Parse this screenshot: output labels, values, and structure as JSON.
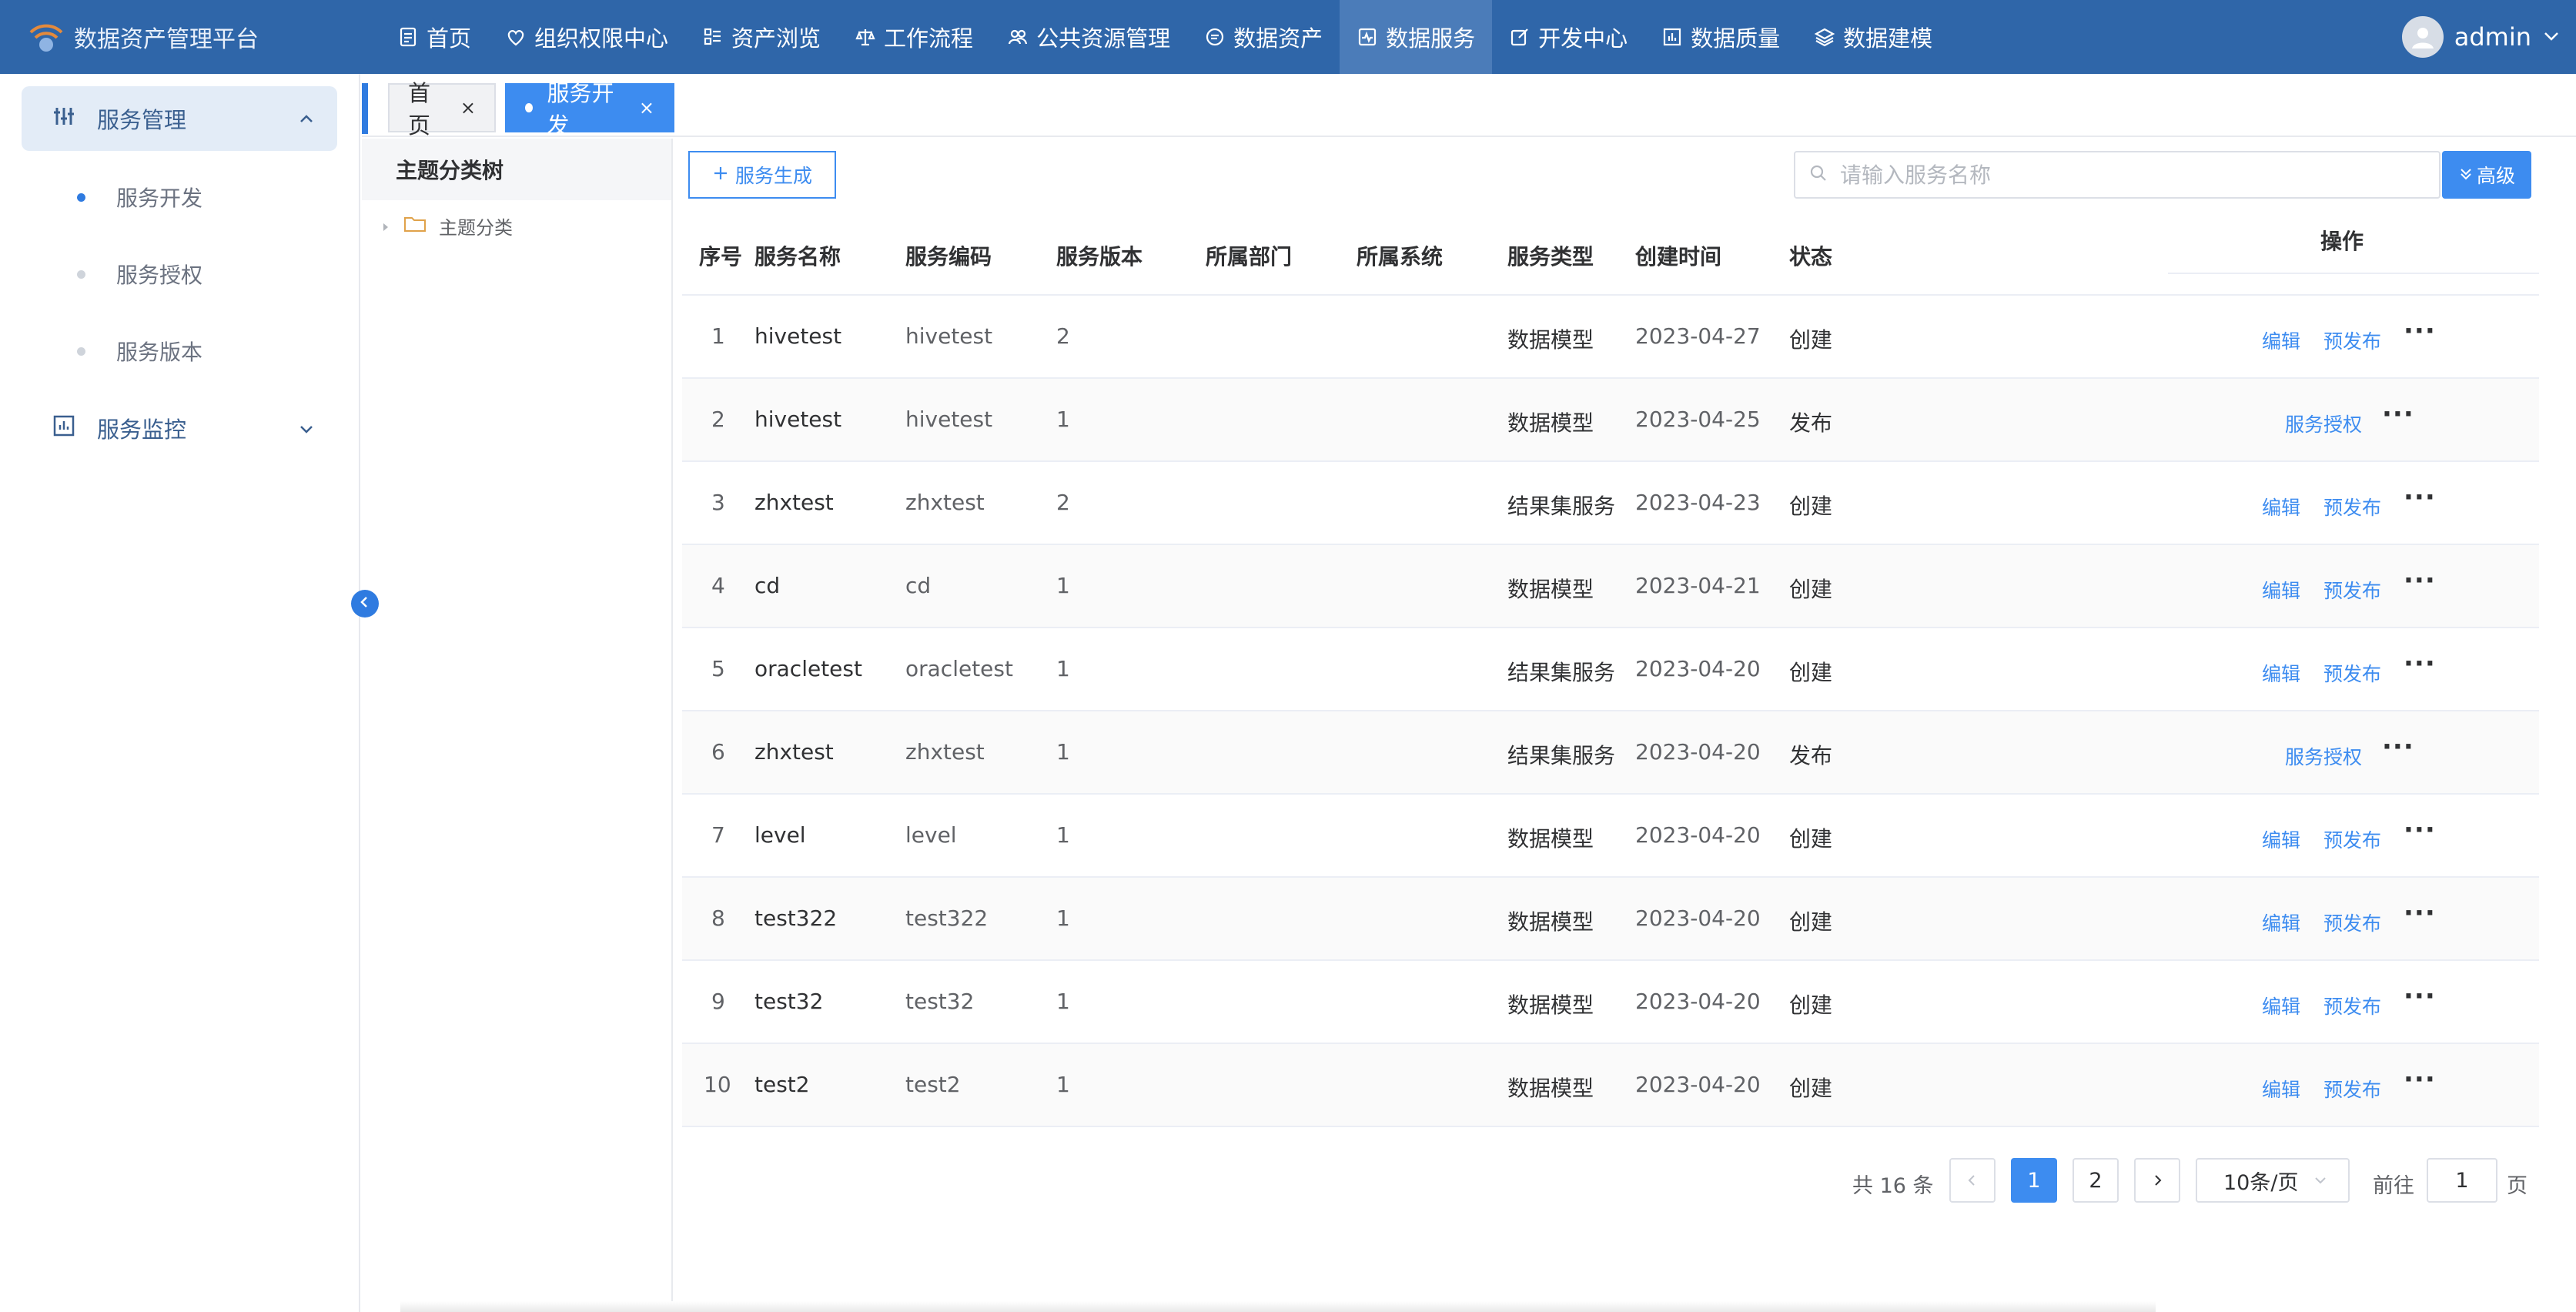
{
  "app": {
    "title": "数据资产管理平台"
  },
  "colors": {
    "header": "#2f66a9",
    "accent": "#3d8cf0",
    "header_active": "#4b7cb9"
  },
  "nav": {
    "items": [
      {
        "label": "首页",
        "icon": "document-icon"
      },
      {
        "label": "组织权限中心",
        "icon": "heart-icon"
      },
      {
        "label": "资产浏览",
        "icon": "list-icon"
      },
      {
        "label": "工作流程",
        "icon": "scale-icon"
      },
      {
        "label": "公共资源管理",
        "icon": "people-icon"
      },
      {
        "label": "数据资产",
        "icon": "chat-icon"
      },
      {
        "label": "数据服务",
        "icon": "pulse-icon",
        "active": true
      },
      {
        "label": "开发中心",
        "icon": "edit-icon"
      },
      {
        "label": "数据质量",
        "icon": "chart-icon"
      },
      {
        "label": "数据建模",
        "icon": "layers-icon"
      }
    ]
  },
  "user": {
    "name": "admin"
  },
  "sidebar": {
    "groups": [
      {
        "label": "服务管理",
        "icon": "sliders-icon",
        "expanded": true,
        "items": [
          {
            "label": "服务开发",
            "active": true
          },
          {
            "label": "服务授权"
          },
          {
            "label": "服务版本"
          }
        ]
      },
      {
        "label": "服务监控",
        "icon": "monitor-chart-icon",
        "expanded": false
      }
    ]
  },
  "tabs": [
    {
      "label": "首页",
      "close": "×"
    },
    {
      "label": "服务开发",
      "close": "×",
      "active": true
    }
  ],
  "tree": {
    "title": "主题分类树",
    "root": "主题分类"
  },
  "toolbar": {
    "create_label": "服务生成",
    "search_placeholder": "请输入服务名称",
    "advanced_label": "高级"
  },
  "table": {
    "columns": [
      "序号",
      "服务名称",
      "服务编码",
      "服务版本",
      "所属部门",
      "所属系统",
      "服务类型",
      "创建时间",
      "状态",
      "操作"
    ],
    "rows": [
      {
        "no": "1",
        "name": "hivetest",
        "code": "hivetest",
        "version": "2",
        "dept": "",
        "system": "",
        "type": "数据模型",
        "created": "2023-04-27",
        "status": "创建"
      },
      {
        "no": "2",
        "name": "hivetest",
        "code": "hivetest",
        "version": "1",
        "dept": "",
        "system": "",
        "type": "数据模型",
        "created": "2023-04-25",
        "status": "发布"
      },
      {
        "no": "3",
        "name": "zhxtest",
        "code": "zhxtest",
        "version": "2",
        "dept": "",
        "system": "",
        "type": "结果集服务",
        "created": "2023-04-23",
        "status": "创建"
      },
      {
        "no": "4",
        "name": "cd",
        "code": "cd",
        "version": "1",
        "dept": "",
        "system": "",
        "type": "数据模型",
        "created": "2023-04-21",
        "status": "创建"
      },
      {
        "no": "5",
        "name": "oracletest",
        "code": "oracletest",
        "version": "1",
        "dept": "",
        "system": "",
        "type": "结果集服务",
        "created": "2023-04-20",
        "status": "创建"
      },
      {
        "no": "6",
        "name": "zhxtest",
        "code": "zhxtest",
        "version": "1",
        "dept": "",
        "system": "",
        "type": "结果集服务",
        "created": "2023-04-20",
        "status": "发布"
      },
      {
        "no": "7",
        "name": "level",
        "code": "level",
        "version": "1",
        "dept": "",
        "system": "",
        "type": "数据模型",
        "created": "2023-04-20",
        "status": "创建"
      },
      {
        "no": "8",
        "name": "test322",
        "code": "test322",
        "version": "1",
        "dept": "",
        "system": "",
        "type": "数据模型",
        "created": "2023-04-20",
        "status": "创建"
      },
      {
        "no": "9",
        "name": "test32",
        "code": "test32",
        "version": "1",
        "dept": "",
        "system": "",
        "type": "数据模型",
        "created": "2023-04-20",
        "status": "创建"
      },
      {
        "no": "10",
        "name": "test2",
        "code": "test2",
        "version": "1",
        "dept": "",
        "system": "",
        "type": "数据模型",
        "created": "2023-04-20",
        "status": "创建"
      }
    ],
    "actions": {
      "edit": "编辑",
      "prepublish": "预发布",
      "authorize": "服务授权",
      "more": "···"
    }
  },
  "pagination": {
    "total_text": "共 16 条",
    "pages": [
      "1",
      "2"
    ],
    "current": "1",
    "page_size": "10条/页",
    "goto_prefix": "前往",
    "goto_value": "1",
    "goto_suffix": "页"
  }
}
